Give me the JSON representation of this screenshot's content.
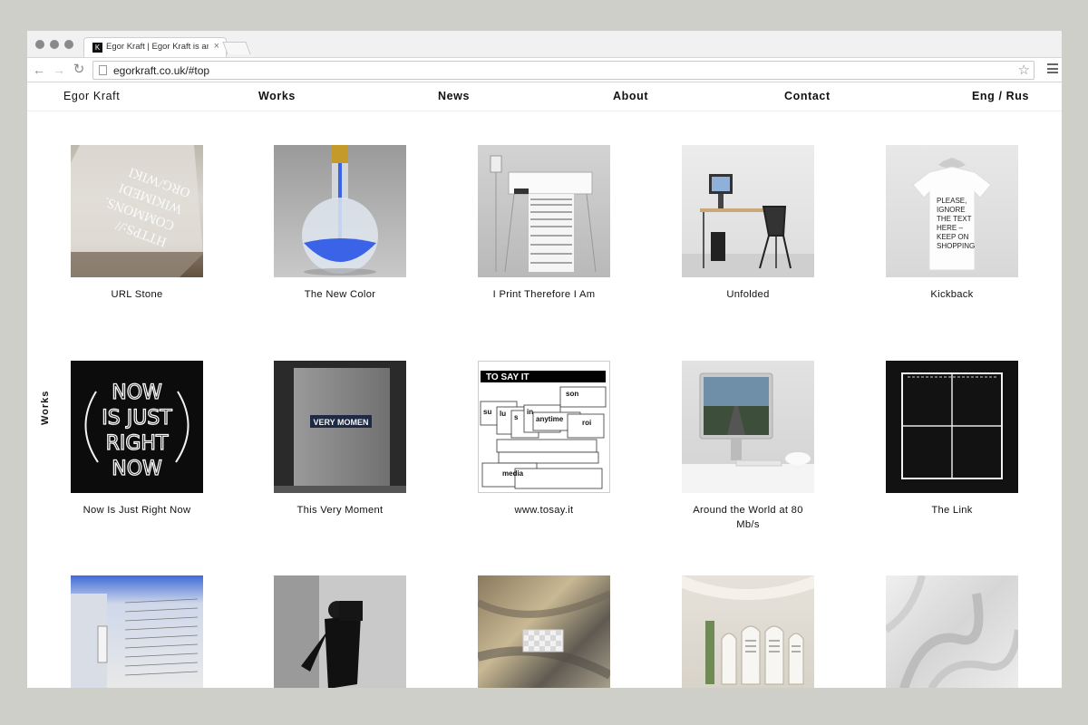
{
  "browser": {
    "tab_favicon": "K",
    "tab_title": "Egor Kraft | Egor Kraft is an",
    "tab_close": "×",
    "url": "egorkraft.co.uk/#top",
    "back_icon": "arrow-left-icon",
    "forward_icon": "arrow-right-icon",
    "reload_icon": "reload-icon",
    "star_icon": "star-icon",
    "menu_icon": "hamburger-menu-icon"
  },
  "nav": {
    "brand": "Egor Kraft",
    "works": "Works",
    "news": "News",
    "about": "About",
    "contact": "Contact",
    "lang": "Eng / Rus"
  },
  "side_label": "Works",
  "works": [
    {
      "title": "URL Stone"
    },
    {
      "title": "The New Color"
    },
    {
      "title": "I Print Therefore I Am"
    },
    {
      "title": "Unfolded"
    },
    {
      "title": "Kickback"
    },
    {
      "title": "Now Is Just Right Now"
    },
    {
      "title": "This Very Moment"
    },
    {
      "title": "www.tosay.it"
    },
    {
      "title": "Around the World at 80 Mb/s"
    },
    {
      "title": "The Link"
    },
    {
      "title": ""
    },
    {
      "title": ""
    },
    {
      "title": ""
    },
    {
      "title": ""
    },
    {
      "title": ""
    }
  ],
  "thumb_text": {
    "url_stone": [
      "HTTPS://",
      "COMMONS.",
      "WIKIMEDI",
      "ORG/WIKI"
    ],
    "kickback": [
      "PLEASE,",
      "IGNORE",
      "THE TEXT",
      "HERE –",
      "KEEP ON",
      "SHOPPING"
    ],
    "neon": [
      "NOW",
      "IS JUST",
      "RIGHT",
      "NOW"
    ],
    "very_moment": "VERY MOMEN",
    "tosay_head": "TO SAY IT",
    "tosay_words": [
      "son",
      "su",
      "lu",
      "s",
      "in",
      "anytime",
      "roi",
      "media"
    ]
  },
  "colors": {
    "page_bg": "#cfcfca",
    "window_bg": "#ffffff",
    "text": "#111111",
    "blue_pigment": "#3a63e8"
  }
}
